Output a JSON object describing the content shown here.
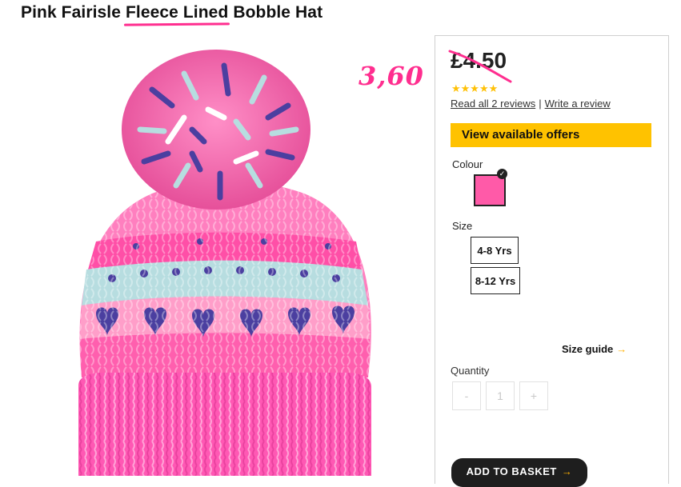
{
  "product": {
    "title_part1": "Pink Fairisle ",
    "title_emph": "Fleece Lined",
    "title_part2": " Bobble Hat",
    "old_price": "£4.50",
    "handwritten_price": "3,60",
    "stars": "★★★★★",
    "rating": 5,
    "reviews_link": "Read all 2 reviews",
    "reviews_separator": "|",
    "write_review_link": "Write a review",
    "offers_button": "View available offers",
    "colour_label": "Colour",
    "size_label": "Size",
    "sizes": [
      "4-8 Yrs",
      "8-12 Yrs"
    ],
    "size_guide": "Size guide",
    "size_guide_arrow": "→",
    "quantity_label": "Quantity",
    "qty_minus": "-",
    "qty_value": "1",
    "qty_plus": "+",
    "basket_button": "ADD TO BASKET",
    "basket_arrow": "→"
  },
  "colors": {
    "accent_yellow": "#ffc200",
    "annotation_pink": "#ff2e8f",
    "swatch_pink": "#ff5aa8",
    "basket_bg": "#1e1e1e"
  }
}
